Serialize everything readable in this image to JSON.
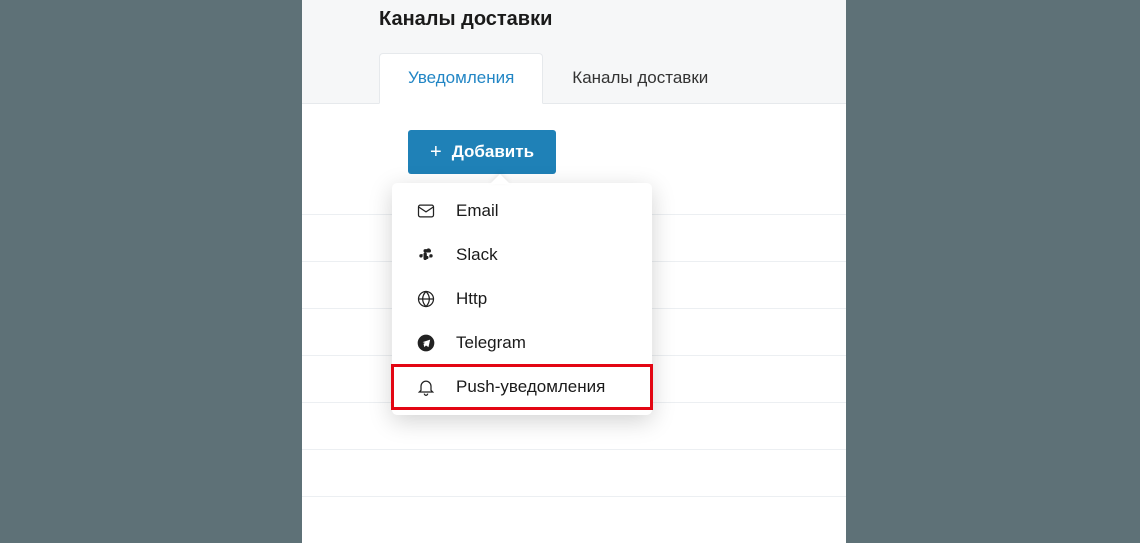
{
  "title": "Каналы доставки",
  "tabs": {
    "notifications": "Уведомления",
    "delivery": "Каналы доставки"
  },
  "buttons": {
    "add": "Добавить"
  },
  "dropdown": {
    "email": "Email",
    "slack": "Slack",
    "http": "Http",
    "telegram": "Telegram",
    "push": "Push-уведомления"
  }
}
